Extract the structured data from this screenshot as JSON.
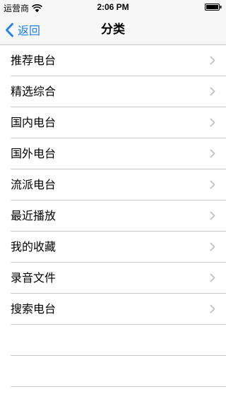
{
  "status_bar": {
    "carrier": "运营商",
    "time": "2:06 PM"
  },
  "nav": {
    "back_label": "返回",
    "title": "分类"
  },
  "items": [
    {
      "label": "推荐电台"
    },
    {
      "label": "精选综合"
    },
    {
      "label": "国内电台"
    },
    {
      "label": "国外电台"
    },
    {
      "label": "流派电台"
    },
    {
      "label": "最近播放"
    },
    {
      "label": "我的收藏"
    },
    {
      "label": "录音文件"
    },
    {
      "label": "搜索电台"
    }
  ],
  "colors": {
    "accent": "#1a82fb",
    "separator": "#c8c7cc",
    "chevron": "#c7c7cc"
  }
}
